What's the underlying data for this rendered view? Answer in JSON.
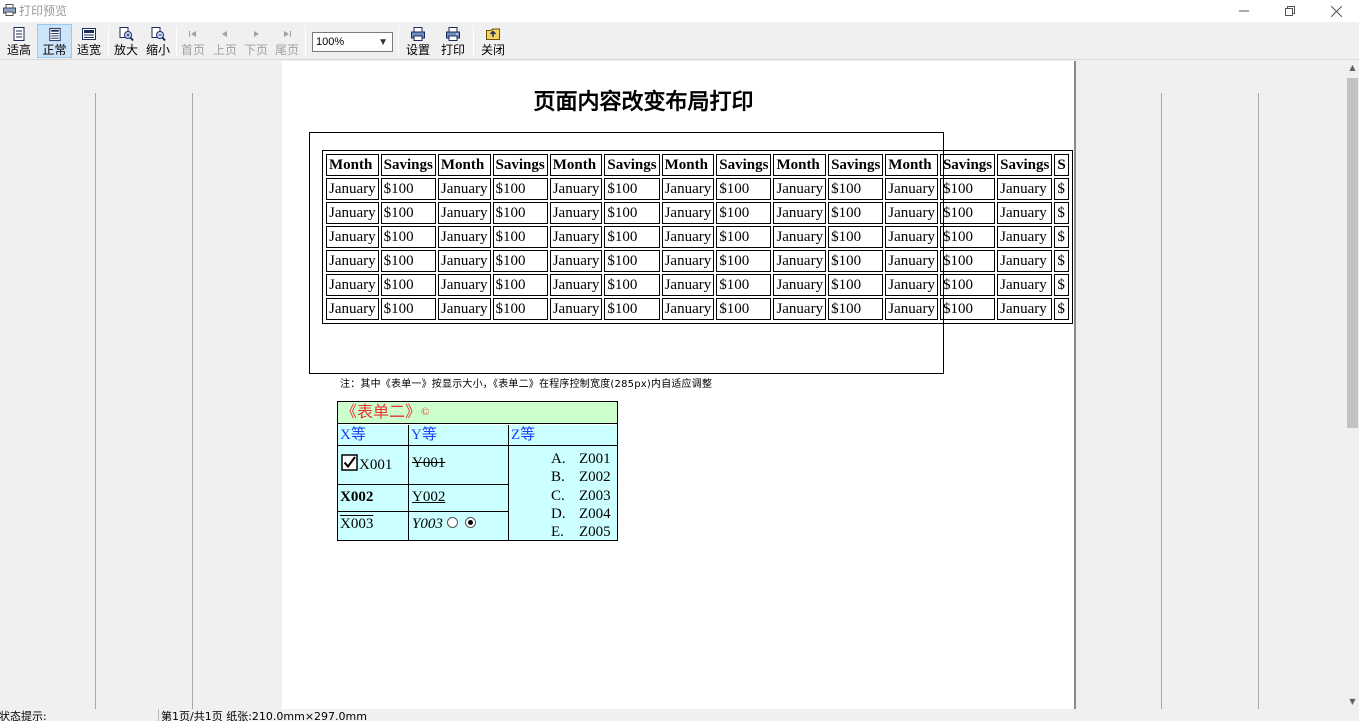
{
  "window": {
    "title": "打印预览"
  },
  "toolbar": {
    "buttons": [
      {
        "id": "fit-height",
        "label": "适高",
        "icon": "fit-height-icon"
      },
      {
        "id": "normal",
        "label": "正常",
        "icon": "normal-view-icon",
        "active": true
      },
      {
        "id": "fit-width",
        "label": "适宽",
        "icon": "fit-width-icon"
      },
      {
        "id": "zoom-in",
        "label": "放大",
        "icon": "zoom-in-icon"
      },
      {
        "id": "zoom-out",
        "label": "缩小",
        "icon": "zoom-out-icon"
      },
      {
        "id": "first-page",
        "label": "首页",
        "icon": "first-page-icon",
        "disabled": true
      },
      {
        "id": "prev-page",
        "label": "上页",
        "icon": "prev-page-icon",
        "disabled": true
      },
      {
        "id": "next-page",
        "label": "下页",
        "icon": "next-page-icon",
        "disabled": true
      },
      {
        "id": "last-page",
        "label": "尾页",
        "icon": "last-page-icon",
        "disabled": true
      },
      {
        "id": "settings",
        "label": "设置",
        "icon": "printer-settings-icon"
      },
      {
        "id": "print",
        "label": "打印",
        "icon": "printer-icon"
      },
      {
        "id": "close",
        "label": "关闭",
        "icon": "close-folder-icon"
      }
    ],
    "zoom": "100%"
  },
  "page": {
    "title": "页面内容改变布局打印",
    "form1": {
      "headers": [
        "Month",
        "Savings",
        "Month",
        "Savings",
        "Month",
        "Savings",
        "Month",
        "Savings",
        "Month",
        "Savings",
        "Month",
        "Savings",
        "Savings",
        "S"
      ],
      "row": [
        "January",
        "$100",
        "January",
        "$100",
        "January",
        "$100",
        "January",
        "$100",
        "January",
        "$100",
        "January",
        "$100",
        "January",
        "$"
      ],
      "row_count": 6
    },
    "note": "注：其中《表单一》按显示大小，《表单二》在程序控制宽度(285px)内自适应调整",
    "form2": {
      "header": "《表单二》",
      "header_symbol": "©",
      "col_x": "X等",
      "col_y": "Y等",
      "col_z": "Z等",
      "x1": "X001",
      "y1": "Y001",
      "x2": "X002",
      "y2": "Y002",
      "x3": "X003",
      "y3": "Y003",
      "z_items": [
        {
          "letter": "A.",
          "value": "Z001"
        },
        {
          "letter": "B.",
          "value": "Z002"
        },
        {
          "letter": "C.",
          "value": "Z003"
        },
        {
          "letter": "D.",
          "value": "Z004"
        },
        {
          "letter": "E.",
          "value": "Z005"
        }
      ]
    }
  },
  "status": {
    "hint": "状态提示:",
    "page_info": "第1页/共1页  纸张:210.0mm×297.0mm"
  },
  "colors": {
    "form2_header_bg": "#ccffcc",
    "form2_body_bg": "#ccffff",
    "form2_header_text": "#e83232",
    "form2_col_text": "#1a3cff",
    "active_btn": "#cce4f7"
  }
}
